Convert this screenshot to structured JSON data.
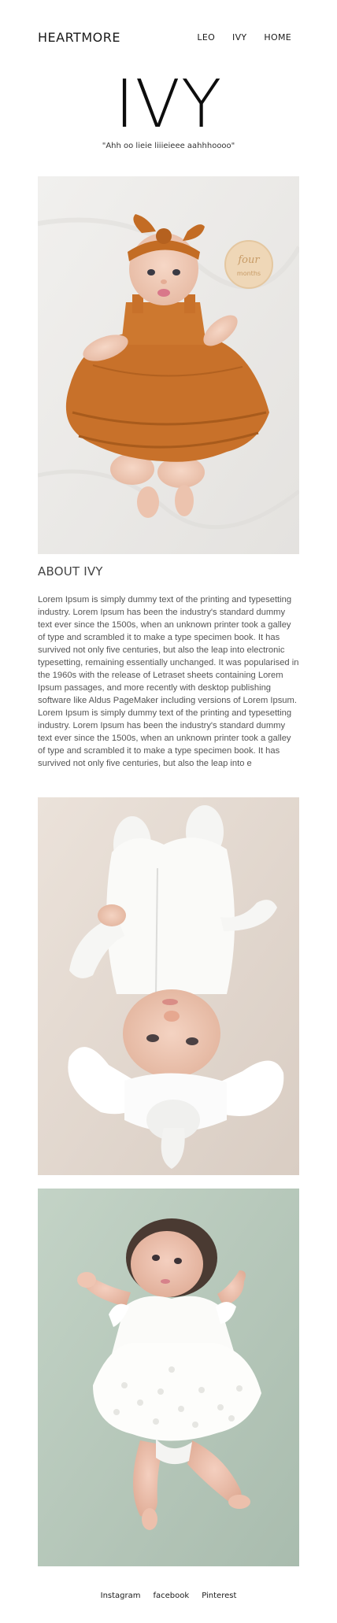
{
  "header": {
    "brand": "HEARTMORE",
    "nav": [
      "LEO",
      "IVY",
      "HOME"
    ]
  },
  "hero": {
    "title": "IVY",
    "quote": "\"Ahh oo lieie liiieieee aahhhoooo\""
  },
  "about": {
    "title": "ABOUT IVY",
    "body": "Lorem Ipsum is simply dummy text of the printing and typesetting industry. Lorem Ipsum has been the industry's standard dummy text ever since the 1500s, when an unknown printer took a galley of type and scrambled it to make a type specimen book. It has survived not only five centuries, but also the leap into electronic typesetting, remaining essentially unchanged. It was popularised in the 1960s with the release of Letraset sheets containing Lorem Ipsum passages, and more recently with desktop publishing software like Aldus PageMaker including versions of Lorem Ipsum. Lorem Ipsum is simply dummy text of the printing and typesetting industry. Lorem Ipsum has been the industry's standard dummy text ever since the 1500s, when an unknown printer took a galley of type and scrambled it to make a type specimen book. It has survived not only five centuries, but also the leap into e"
  },
  "photos": {
    "milestone_card": {
      "line1": "four",
      "line2": "months"
    }
  },
  "footer": {
    "links": [
      "Instagram",
      "facebook",
      "Pinterest"
    ]
  },
  "colors": {
    "text": "#1a1a1a",
    "muted": "#555555",
    "dress_orange": "#c9762f",
    "skin": "#efc9b5",
    "mint_bg": "#b9cbbd"
  }
}
